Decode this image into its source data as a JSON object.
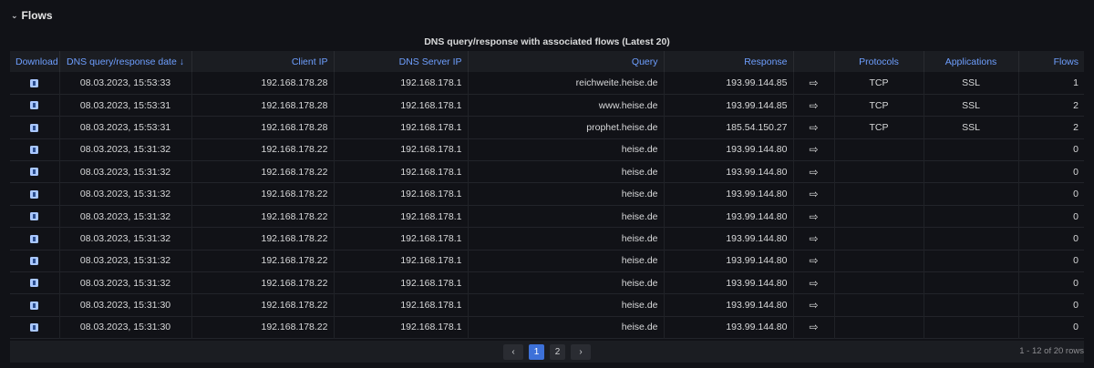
{
  "section": {
    "title": "Flows"
  },
  "panel": {
    "title": "DNS query/response with associated flows (Latest 20)"
  },
  "columns": [
    "Download",
    "DNS query/response date ↓",
    "Client IP",
    "DNS Server IP",
    "Query",
    "Response",
    "",
    "Protocols",
    "Applications",
    "Flows"
  ],
  "rows": [
    {
      "date": "08.03.2023, 15:53:33",
      "client": "192.168.178.28",
      "server": "192.168.178.1",
      "query": "reichweite.heise.de",
      "response": "193.99.144.85",
      "protocols": "TCP",
      "applications": "SSL",
      "flows": "1"
    },
    {
      "date": "08.03.2023, 15:53:31",
      "client": "192.168.178.28",
      "server": "192.168.178.1",
      "query": "www.heise.de",
      "response": "193.99.144.85",
      "protocols": "TCP",
      "applications": "SSL",
      "flows": "2"
    },
    {
      "date": "08.03.2023, 15:53:31",
      "client": "192.168.178.28",
      "server": "192.168.178.1",
      "query": "prophet.heise.de",
      "response": "185.54.150.27",
      "protocols": "TCP",
      "applications": "SSL",
      "flows": "2"
    },
    {
      "date": "08.03.2023, 15:31:32",
      "client": "192.168.178.22",
      "server": "192.168.178.1",
      "query": "heise.de",
      "response": "193.99.144.80",
      "protocols": "",
      "applications": "",
      "flows": "0"
    },
    {
      "date": "08.03.2023, 15:31:32",
      "client": "192.168.178.22",
      "server": "192.168.178.1",
      "query": "heise.de",
      "response": "193.99.144.80",
      "protocols": "",
      "applications": "",
      "flows": "0"
    },
    {
      "date": "08.03.2023, 15:31:32",
      "client": "192.168.178.22",
      "server": "192.168.178.1",
      "query": "heise.de",
      "response": "193.99.144.80",
      "protocols": "",
      "applications": "",
      "flows": "0"
    },
    {
      "date": "08.03.2023, 15:31:32",
      "client": "192.168.178.22",
      "server": "192.168.178.1",
      "query": "heise.de",
      "response": "193.99.144.80",
      "protocols": "",
      "applications": "",
      "flows": "0"
    },
    {
      "date": "08.03.2023, 15:31:32",
      "client": "192.168.178.22",
      "server": "192.168.178.1",
      "query": "heise.de",
      "response": "193.99.144.80",
      "protocols": "",
      "applications": "",
      "flows": "0"
    },
    {
      "date": "08.03.2023, 15:31:32",
      "client": "192.168.178.22",
      "server": "192.168.178.1",
      "query": "heise.de",
      "response": "193.99.144.80",
      "protocols": "",
      "applications": "",
      "flows": "0"
    },
    {
      "date": "08.03.2023, 15:31:32",
      "client": "192.168.178.22",
      "server": "192.168.178.1",
      "query": "heise.de",
      "response": "193.99.144.80",
      "protocols": "",
      "applications": "",
      "flows": "0"
    },
    {
      "date": "08.03.2023, 15:31:30",
      "client": "192.168.178.22",
      "server": "192.168.178.1",
      "query": "heise.de",
      "response": "193.99.144.80",
      "protocols": "",
      "applications": "",
      "flows": "0"
    },
    {
      "date": "08.03.2023, 15:31:30",
      "client": "192.168.178.22",
      "server": "192.168.178.1",
      "query": "heise.de",
      "response": "193.99.144.80",
      "protocols": "",
      "applications": "",
      "flows": "0"
    }
  ],
  "pagination": {
    "prev": "‹",
    "pages": [
      "1",
      "2"
    ],
    "current": "1",
    "next": "›",
    "summary": "1 - 12 of 20 rows"
  },
  "icons": {
    "download": "download-icon",
    "arrow": "arrow-right-icon"
  },
  "colors": {
    "header_text": "#6e9fff",
    "active_page": "#3d71d9",
    "background": "#111217"
  }
}
